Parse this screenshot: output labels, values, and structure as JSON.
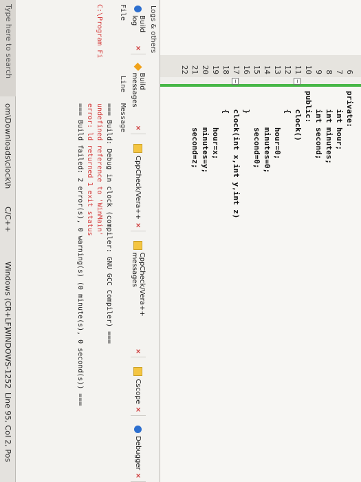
{
  "editor": {
    "line_numbers": [
      "6",
      "7",
      "8",
      "9",
      "10",
      "11",
      "12",
      "13",
      "14",
      "15",
      "16",
      "17",
      "18",
      "19",
      "20",
      "21",
      "22"
    ],
    "code_lines": [
      "private:",
      "    int hour;",
      "    int minutes;",
      "    int second;",
      "public:",
      "    clock()",
      "    {",
      "        hour=0;",
      "        minutes=0;",
      "        second=0;",
      "    }",
      "    clock(int x,int y,int z)",
      "    {",
      "        hour=x;",
      "        minutes=y;",
      "        second=z;",
      ""
    ]
  },
  "logs": {
    "title": "Logs & others",
    "tabs": [
      {
        "label": "Build log",
        "icon": "gear-icon"
      },
      {
        "label": "Build messages",
        "icon": "diamond-icon"
      },
      {
        "label": "CppCheck/Vera++",
        "icon": "doc-icon"
      },
      {
        "label": "CppCheck/Vera++ messages",
        "icon": "doc-icon"
      },
      {
        "label": "Cscope",
        "icon": "doc-icon"
      },
      {
        "label": "Debugger",
        "icon": "gear-icon"
      }
    ],
    "columns": {
      "file": "File",
      "line": "Line",
      "message": "Message"
    },
    "file_cell": "C:\\Program Fi",
    "messages": [
      {
        "text": "=== Build: Debug in clock (compiler: GNU GCC Compiler) ===",
        "color": "black"
      },
      {
        "text": "undefined reference to 'WinMain'",
        "color": "red"
      },
      {
        "text": "error: ld returned 1 exit status",
        "color": "red"
      },
      {
        "text": "=== Build failed: 2 error(s), 0 warning(s) (0 minute(s), 0 second(s)) ===",
        "color": "black"
      }
    ]
  },
  "status": {
    "path": "om\\Downloads\\clock\\h",
    "language": "C/C++",
    "eol": "Windows (CR+LF)",
    "encoding": "WINDOWS-1252",
    "position": "Line 95, Col 2, Pos"
  },
  "taskbar": {
    "search_placeholder": "Type here to search"
  }
}
